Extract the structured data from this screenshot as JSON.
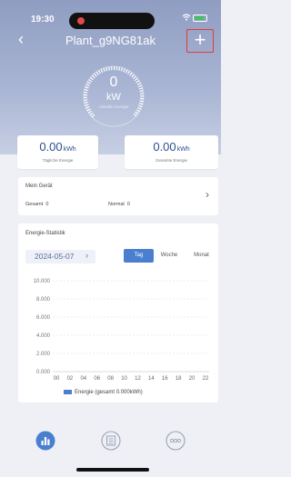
{
  "status_bar": {
    "time": "19:30"
  },
  "header": {
    "back_glyph": "‹",
    "title": "Plant_g9NG81ak",
    "add_glyph": "+"
  },
  "gauge": {
    "value": "0",
    "unit": "kW",
    "label": "Aktuelle Energie"
  },
  "energy_cards": [
    {
      "value": "0.00",
      "unit": "kWh",
      "label": "Tägliche Energie"
    },
    {
      "value": "0.00",
      "unit": "kWh",
      "label": "Gesamte Energie"
    }
  ],
  "device": {
    "title": "Mein Gerät",
    "total_label": "Gesamt",
    "total_value": "0",
    "normal_label": "Normal",
    "normal_value": "0",
    "chevron": "›"
  },
  "stats": {
    "title": "Energie-Statistik",
    "date": "2024-05-07",
    "date_arrow": "›",
    "periods": [
      "Tag",
      "Woche",
      "Monat"
    ],
    "active_period": "Tag",
    "legend": "Energie (gesamt 0.000kWh)"
  },
  "chart_data": {
    "type": "bar",
    "x_ticks": [
      "00",
      "02",
      "04",
      "06",
      "08",
      "10",
      "12",
      "14",
      "16",
      "18",
      "20",
      "22"
    ],
    "y_ticks": [
      "10.000",
      "8.000",
      "6.000",
      "4.000",
      "2.000",
      "0.000"
    ],
    "ylim": [
      0,
      10
    ],
    "series": [
      {
        "name": "Energie (gesamt 0.000kWh)",
        "values": [
          0,
          0,
          0,
          0,
          0,
          0,
          0,
          0,
          0,
          0,
          0,
          0
        ]
      }
    ],
    "grid": true,
    "legend_position": "bottom"
  },
  "tabs": [
    {
      "icon": "chart-icon",
      "active": true
    },
    {
      "icon": "device-icon",
      "active": false
    },
    {
      "icon": "more-icon",
      "active": false
    }
  ],
  "colors": {
    "accent": "#4a7fd0",
    "value": "#2b4e8f",
    "highlight": "#e53935"
  }
}
